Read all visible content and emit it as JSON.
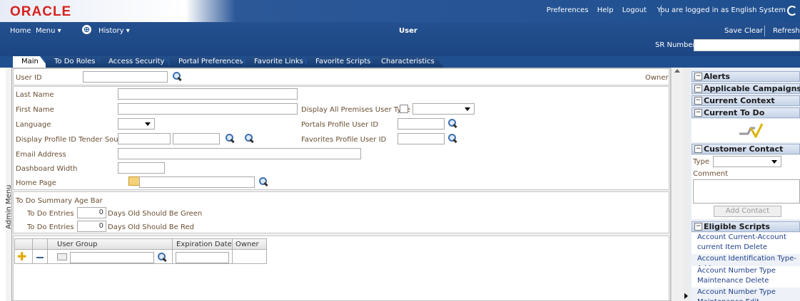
{
  "header": {
    "logo": "ORACLE",
    "links": [
      "Preferences",
      "Help",
      "Logout"
    ],
    "logged_in": "You are logged in as English System"
  },
  "nav": {
    "home": "Home",
    "menu": "Menu ▾",
    "history": "History ▾",
    "title": "User",
    "save": "Save",
    "clear": "Clear",
    "refresh": "Refresh",
    "sr_label": "SR Number",
    "sr_value": ""
  },
  "tabs": [
    "Main",
    "To Do Roles",
    "Access Security",
    "Portal Preferences",
    "Favorite Links",
    "Favorite Scripts",
    "Characteristics"
  ],
  "main": {
    "user_id_label": "User ID",
    "user_id_value": "",
    "owner_label": "Owner",
    "last_name": "Last Name",
    "first_name": "First Name",
    "language": "Language",
    "display_profile": "Display Profile ID Tender Source",
    "email": "Email Address",
    "dashboard_width": "Dashboard Width",
    "home_page": "Home Page",
    "display_all_premises": "Display All Premises User Type",
    "portals_profile": "Portals Profile User ID",
    "favorites_profile": "Favorites Profile User ID"
  },
  "todo_bar": {
    "title": "To Do Summary Age Bar",
    "entries_lt": "To Do Entries <",
    "green_value": "0",
    "green_label": "Days Old Should Be Green",
    "entries_gt": "To Do Entries >",
    "red_value": "0",
    "red_label": "Days Old Should Be Red"
  },
  "grid": {
    "headers": [
      "User Group",
      "Expiration Date",
      "Owner"
    ]
  },
  "admin_menu": "Admin Menu",
  "right": {
    "alerts": "Alerts",
    "campaigns": "Applicable Campaigns",
    "context": "Current Context",
    "todo": "Current To Do",
    "customer_contact": "Customer Contact",
    "type": "Type",
    "comment": "Comment",
    "add_contact": "Add Contact",
    "eligible_scripts": "Eligible Scripts",
    "scripts": [
      "Account Current-Account current Item Delete",
      "Account Identification Type-Add",
      "Account Number Type Maintenance Delete",
      "Account Number Type Maintenance Edit"
    ]
  }
}
